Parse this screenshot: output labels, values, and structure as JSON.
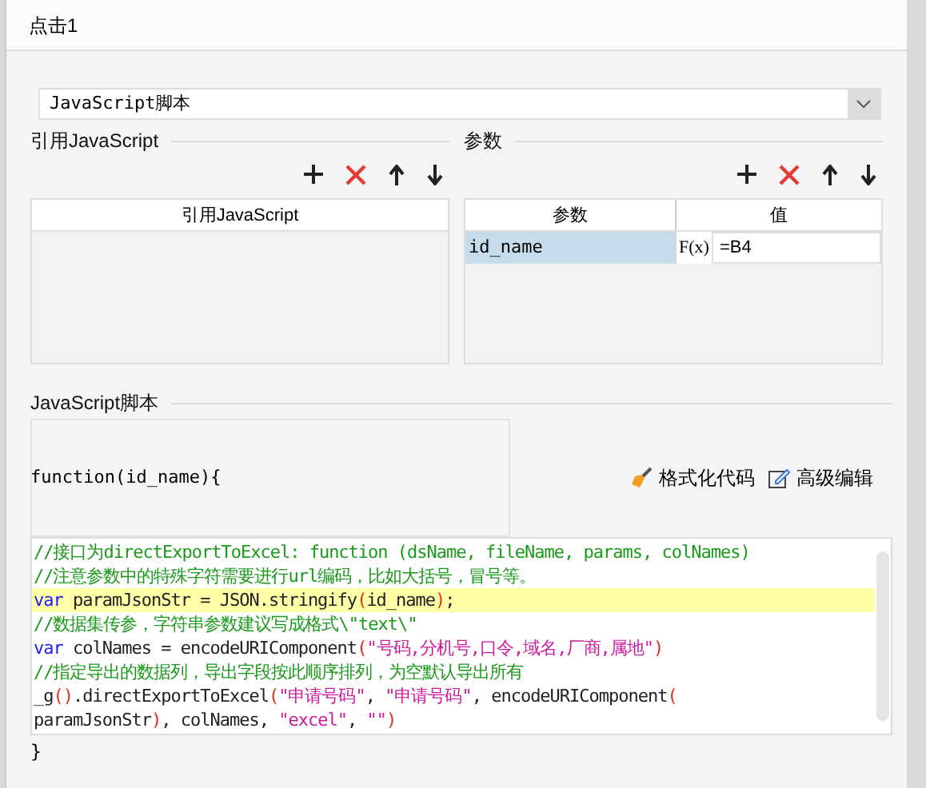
{
  "window": {
    "title": "点击1"
  },
  "script_type": {
    "value": "JavaScript脚本"
  },
  "referenced_js": {
    "title": "引用JavaScript",
    "columns": [
      "引用JavaScript"
    ]
  },
  "params": {
    "title": "参数",
    "columns": [
      "参数",
      "值"
    ],
    "rows": [
      {
        "name": "id_name",
        "formula_icon": "F(x)",
        "value": "=B4",
        "selected": true
      }
    ]
  },
  "script": {
    "title": "JavaScript脚本",
    "header": "function(id_name){",
    "actions": [
      "格式化代码",
      "高级编辑"
    ],
    "lines": [
      {
        "highlighted": false,
        "tokens": [
          {
            "kind": "comment",
            "text": "//接口为directExportToExcel: function (dsName, fileName, params, colNames)"
          }
        ]
      },
      {
        "highlighted": false,
        "tokens": [
          {
            "kind": "comment",
            "text": "//注意参数中的特殊字符需要进行url编码，比如大括号，冒号等。"
          }
        ]
      },
      {
        "highlighted": true,
        "tokens": [
          {
            "kind": "keyword",
            "text": "var"
          },
          {
            "kind": "plain",
            "text": " paramJsonStr = JSON.stringify"
          },
          {
            "kind": "paren",
            "text": "("
          },
          {
            "kind": "plain",
            "text": "id_name"
          },
          {
            "kind": "paren",
            "text": ")"
          },
          {
            "kind": "plain",
            "text": ";"
          }
        ]
      },
      {
        "highlighted": false,
        "tokens": [
          {
            "kind": "comment",
            "text": "//数据集传参，字符串参数建议写成格式\\\"text\\\""
          }
        ]
      },
      {
        "highlighted": false,
        "tokens": [
          {
            "kind": "keyword",
            "text": "var"
          },
          {
            "kind": "plain",
            "text": " colNames = encodeURIComponent"
          },
          {
            "kind": "paren",
            "text": "("
          },
          {
            "kind": "string",
            "text": "\"号码,分机号,口令,域名,厂商,属地\""
          },
          {
            "kind": "paren",
            "text": ")"
          }
        ]
      },
      {
        "highlighted": false,
        "tokens": [
          {
            "kind": "comment",
            "text": "//指定导出的数据列，导出字段按此顺序排列，为空默认导出所有"
          }
        ]
      },
      {
        "highlighted": false,
        "tokens": [
          {
            "kind": "plain",
            "text": "_g"
          },
          {
            "kind": "paren",
            "text": "()"
          },
          {
            "kind": "plain",
            "text": ".directExportToExcel"
          },
          {
            "kind": "paren",
            "text": "("
          },
          {
            "kind": "string",
            "text": "\"申请号码\""
          },
          {
            "kind": "plain",
            "text": ", "
          },
          {
            "kind": "string",
            "text": "\"申请号码\""
          },
          {
            "kind": "plain",
            "text": ", encodeURIComponent"
          },
          {
            "kind": "paren",
            "text": "("
          }
        ]
      },
      {
        "highlighted": false,
        "tokens": [
          {
            "kind": "plain",
            "text": "paramJsonStr"
          },
          {
            "kind": "paren",
            "text": ")"
          },
          {
            "kind": "plain",
            "text": ", colNames, "
          },
          {
            "kind": "string",
            "text": "\"excel\""
          },
          {
            "kind": "plain",
            "text": ", "
          },
          {
            "kind": "string",
            "text": "\"\""
          },
          {
            "kind": "paren",
            "text": ")"
          }
        ]
      }
    ],
    "footer": "}"
  }
}
